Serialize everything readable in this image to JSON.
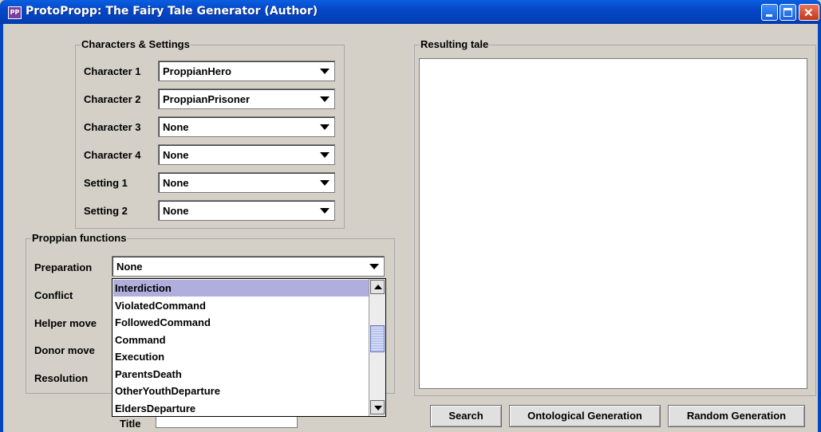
{
  "window": {
    "title": "ProtoPropp: The Fairy Tale Generator (Author)",
    "icon_text": "PP",
    "controls": [
      "minimize-icon",
      "maximize-icon",
      "close-icon"
    ]
  },
  "characters_settings": {
    "group_label": "Characters & Settings",
    "rows": [
      {
        "label": "Character 1",
        "value": "ProppianHero"
      },
      {
        "label": "Character 2",
        "value": "ProppianPrisoner"
      },
      {
        "label": "Character 3",
        "value": "None"
      },
      {
        "label": "Character 4",
        "value": "None"
      },
      {
        "label": "Setting 1",
        "value": "None"
      },
      {
        "label": "Setting 2",
        "value": "None"
      }
    ]
  },
  "proppian_functions": {
    "group_label": "Proppian functions",
    "rows": [
      {
        "label": "Preparation",
        "value": "None"
      },
      {
        "label": "Conflict"
      },
      {
        "label": "Helper move"
      },
      {
        "label": "Donor move"
      },
      {
        "label": "Resolution"
      }
    ],
    "dropdown_options": [
      "Interdiction",
      "ViolatedCommand",
      "FollowedCommand",
      "Command",
      "Execution",
      "ParentsDeath",
      "OtherYouthDeparture",
      "EldersDeparture"
    ],
    "dropdown_selected": "Interdiction"
  },
  "result": {
    "group_label": "Resulting tale",
    "text": ""
  },
  "title_field": {
    "partial_label": "Title",
    "value": ""
  },
  "buttons": {
    "search": "Search",
    "ontological": "Ontological Generation",
    "random": "Random Generation"
  }
}
